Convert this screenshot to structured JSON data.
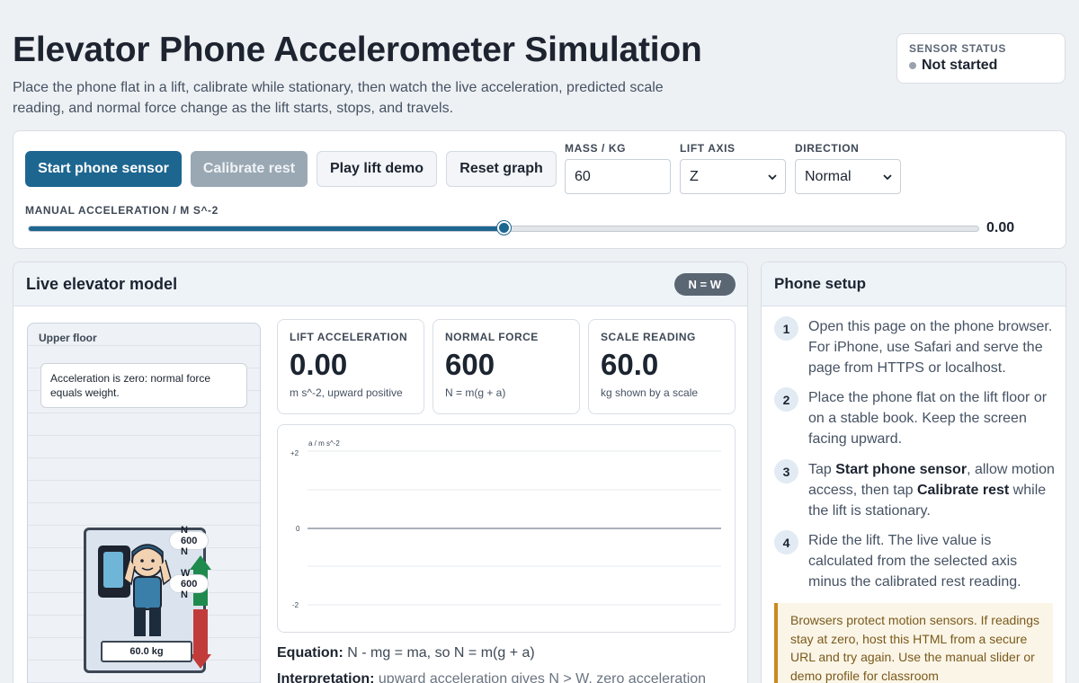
{
  "header": {
    "title": "Elevator Phone Accelerometer Simulation",
    "subtitle": "Place the phone flat in a lift, calibrate while stationary, then watch the live acceleration, predicted scale reading, and normal force change as the lift starts, stops, and travels."
  },
  "sensor_status": {
    "label": "SENSOR STATUS",
    "value": "Not started",
    "dot_color": "#9aa3ad"
  },
  "controls": {
    "start_label": "Start phone sensor",
    "calibrate_label": "Calibrate rest",
    "demo_label": "Play lift demo",
    "reset_label": "Reset graph",
    "mass_label": "MASS / KG",
    "mass_value": "60",
    "axis_label": "LIFT AXIS",
    "axis_value": "Z",
    "direction_label": "DIRECTION",
    "direction_value": "Normal",
    "slider_label": "MANUAL ACCELERATION / M S^-2",
    "slider_value": "0.00",
    "slider_fraction": 0.5
  },
  "model": {
    "title": "Live elevator model",
    "badge": "N = W",
    "shaft_label": "Upper floor",
    "note": "Acceleration is zero: normal force equals weight.",
    "normal_chip": "N 600 N",
    "weight_chip": "W 600 N",
    "scale_reading": "60.0 kg",
    "metrics": [
      {
        "label": "LIFT ACCELERATION",
        "value": "0.00",
        "sub": "m s^-2, upward positive"
      },
      {
        "label": "NORMAL FORCE",
        "value": "600",
        "sub": "N = m(g + a)"
      },
      {
        "label": "SCALE READING",
        "value": "60.0",
        "sub": "kg shown by a scale"
      }
    ],
    "graph": {
      "ylabel": "a / m s^-2",
      "ticks": [
        "+2",
        "0",
        "-2"
      ]
    },
    "equation_label": "Equation:",
    "equation_text": " N - mg = ma, so N = m(g + a)",
    "interp_label": "Interpretation:",
    "interp_text": " upward acceleration gives N > W, zero acceleration"
  },
  "setup": {
    "title": "Phone setup",
    "steps": [
      {
        "num": "1",
        "text": "Open this page on the phone browser. For iPhone, use Safari and serve the page from HTTPS or localhost."
      },
      {
        "num": "2",
        "text": "Place the phone flat on the lift floor or on a stable book. Keep the screen facing upward."
      },
      {
        "num": "3",
        "pre": "Tap ",
        "b1": "Start phone sensor",
        "mid": ", allow motion access, then tap ",
        "b2": "Calibrate rest",
        "post": " while the lift is stationary."
      },
      {
        "num": "4",
        "text": "Ride the lift. The live value is calculated from the selected axis minus the calibrated rest reading."
      }
    ],
    "warning": "Browsers protect motion sensors. If readings stay at zero, host this HTML from a secure URL and try again. Use the manual slider or demo profile for classroom"
  }
}
